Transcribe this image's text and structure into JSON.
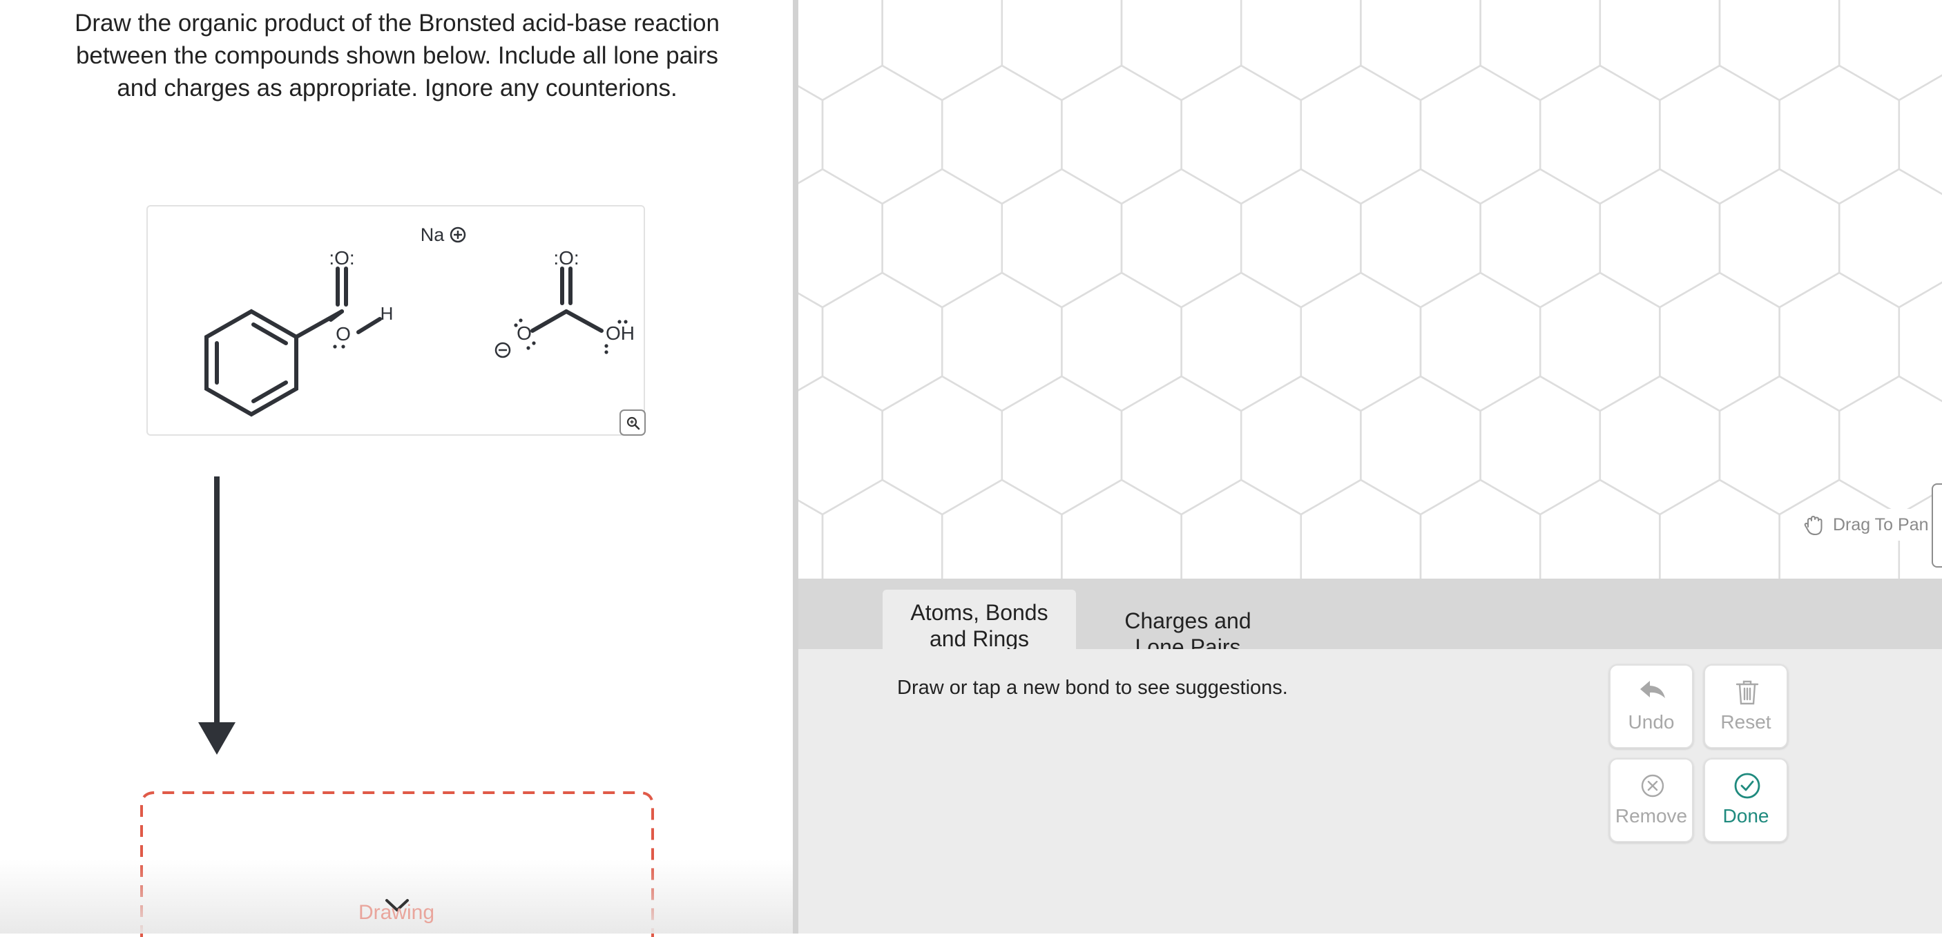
{
  "question": {
    "lines": [
      "Draw the organic product of the Bronsted acid-base reaction",
      "between the compounds shown below. Include all lone pairs",
      "and charges as appropriate. Ignore any counterions."
    ]
  },
  "reactants": {
    "acid_carbonyl_oxygen": ":O:",
    "acid_hydroxyl_oxygen": "O",
    "acid_hydrogen": "H",
    "counterion": "Na",
    "base_carbonyl_oxygen": ":O:",
    "base_anion_oxygen": "O",
    "base_hydroxyl": "OH",
    "zoom_icon": "magnifier-icon"
  },
  "drawing": {
    "label": "Drawing"
  },
  "canvas": {
    "drag_label": "Drag To Pan",
    "drag_icon": "hand-icon"
  },
  "tabs": [
    {
      "line1": "Atoms, Bonds",
      "line2": "and Rings",
      "active": true
    },
    {
      "line1": "Charges and",
      "line2": "Lone Pairs",
      "active": false
    }
  ],
  "tool_panel": {
    "hint": "Draw or tap a new bond to see suggestions.",
    "undo_label": "Undo",
    "reset_label": "Reset",
    "remove_label": "Remove",
    "done_label": "Done"
  },
  "colors": {
    "done_accent": "#1f8a7e",
    "answer_border": "#e05a48",
    "bond": "#2f3238",
    "grid": "#dddddd"
  }
}
